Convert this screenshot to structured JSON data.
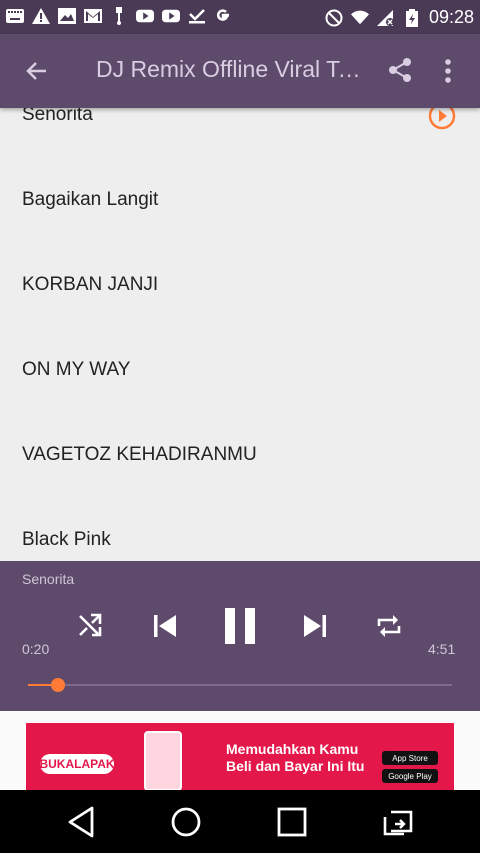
{
  "status_bar": {
    "time": "09:28"
  },
  "app_bar": {
    "title": "DJ Remix Offline Viral Terbaru"
  },
  "songs": [
    {
      "label": "Senorita"
    },
    {
      "label": "Bagaikan Langit"
    },
    {
      "label": "KORBAN JANJI"
    },
    {
      "label": "ON MY WAY"
    },
    {
      "label": "VAGETOZ KEHADIRANMU"
    },
    {
      "label": "Black Pink"
    }
  ],
  "player": {
    "now_playing": "Senorita",
    "elapsed": "0:20",
    "duration": "4:51",
    "progress_fraction": 0.07
  },
  "ad": {
    "brand": "BUKALAPAK",
    "headline_line1": "Memudahkan Kamu",
    "headline_line2": "Beli dan Bayar Ini Itu",
    "store1": "App Store",
    "store2": "Google Play"
  },
  "colors": {
    "status_bar": "#4a3a55",
    "app_bar": "#5e4a6b",
    "player": "#5e4a6b",
    "accent": "#ff7b36",
    "ad_background": "#e3174a"
  },
  "icons": {
    "back": "arrow-back-icon",
    "share": "share-icon",
    "more": "more-vert-icon",
    "play": "play-circle-icon",
    "shuffle": "shuffle-icon",
    "previous": "skip-previous-icon",
    "pause": "pause-icon",
    "next": "skip-next-icon",
    "repeat": "repeat-icon"
  }
}
